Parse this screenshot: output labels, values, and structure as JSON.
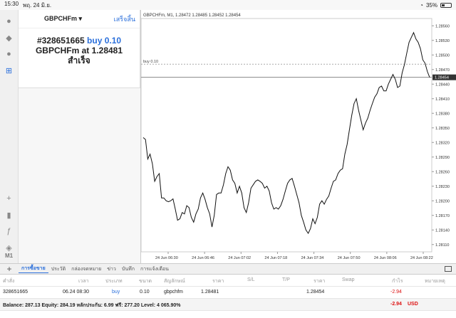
{
  "status": {
    "time": "15:30",
    "date": "พฤ. 24 มิ.ย.",
    "battery": "35%"
  },
  "sidebar": {
    "timeframe": "M1"
  },
  "order_panel": {
    "symbol": "GBPCHFm",
    "done": "เสร็จสิ้น",
    "ticket": "#328651665",
    "action": "buy 0.10",
    "line2_prefix": "GBPCHFm at",
    "line2_price": "1.28481",
    "status": "สำเร็จ"
  },
  "chart": {
    "header": "GBPCHFm, M1, 1.28472 1.28485 1.28452 1.28454",
    "buy_label": "buy 0.10",
    "current_price": "1.28454",
    "y_ticks": [
      "1.28560",
      "1.28530",
      "1.28500",
      "1.28470",
      "1.28440",
      "1.28410",
      "1.28380",
      "1.28350",
      "1.28320",
      "1.28290",
      "1.28260",
      "1.28230",
      "1.28200",
      "1.28170",
      "1.28140",
      "1.28110"
    ],
    "x_ticks": [
      "24 Jun 06:30",
      "24 Jun 06:46",
      "24 Jun 07:02",
      "24 Jun 07:18",
      "24 Jun 07:34",
      "24 Jun 07:50",
      "24 Jun 08:06",
      "24 Jun 08:22"
    ]
  },
  "chart_data": {
    "type": "line",
    "title": "GBPCHFm, M1, 1.28472 1.28485 1.28452 1.28454",
    "xlabel": "",
    "ylabel": "",
    "ylim": [
      1.28095,
      1.28575
    ],
    "series": [
      {
        "values": [
          1.2833,
          1.28326,
          1.28286,
          1.28296,
          1.28276,
          1.2824,
          1.2825,
          1.28256,
          1.28206,
          1.28206,
          1.282,
          1.28198,
          1.282,
          1.28204,
          1.28183,
          1.2816,
          1.28163,
          1.28176,
          1.28173,
          1.2819,
          1.28186,
          1.28166,
          1.28156,
          1.28173,
          1.28183,
          1.28206,
          1.28216,
          1.28203,
          1.28186,
          1.28173,
          1.28146,
          1.2817,
          1.28213,
          1.28216,
          1.28216,
          1.28233,
          1.28256,
          1.2827,
          1.28263,
          1.28243,
          1.28236,
          1.28216,
          1.2823,
          1.28216,
          1.28186,
          1.28176,
          1.28196,
          1.28226,
          1.28233,
          1.2824,
          1.28243,
          1.2824,
          1.28236,
          1.28226,
          1.2823,
          1.2822,
          1.28196,
          1.28183,
          1.28186,
          1.28183,
          1.2819,
          1.28203,
          1.2822,
          1.28236,
          1.28243,
          1.28246,
          1.2823,
          1.28213,
          1.28196,
          1.2817,
          1.28156,
          1.2814,
          1.28133,
          1.28143,
          1.28163,
          1.28153,
          1.28166,
          1.28193,
          1.282,
          1.28193,
          1.28203,
          1.2821,
          1.28226,
          1.2824,
          1.28243,
          1.28256,
          1.28263,
          1.28266,
          1.28296,
          1.28316,
          1.28346,
          1.28376,
          1.284,
          1.2841,
          1.28386,
          1.28366,
          1.28346,
          1.2836,
          1.2837,
          1.28386,
          1.284,
          1.28413,
          1.2842,
          1.28433,
          1.28436,
          1.28426,
          1.28426,
          1.2844,
          1.2845,
          1.2846,
          1.2845,
          1.28433,
          1.28436,
          1.28463,
          1.2848,
          1.28503,
          1.28526,
          1.28536,
          1.28546,
          1.28533,
          1.28526,
          1.28513,
          1.2849,
          1.28483,
          1.28466,
          1.28454
        ]
      }
    ]
  },
  "tabs": [
    "การซื้อขาย",
    "ประวัติ",
    "กล่องจดหมาย",
    "ข่าว",
    "บันทึก",
    "การแจ้งเตือน"
  ],
  "table": {
    "headers": [
      "คำสั่ง",
      "เวลา",
      "ประเภท",
      "ขนาด",
      "สัญลักษณ์",
      "ราคา",
      "S/L",
      "T/P",
      "ราคา",
      "Swap",
      "กำไร",
      "หมายเหตุ"
    ],
    "row": [
      "328651665",
      "06.24 08:30",
      "buy",
      "0.10",
      "gbpchfm",
      "1.28481",
      "",
      "",
      "1.28454",
      "",
      "-2.94",
      ""
    ],
    "balance": "Balance: 287.13 Equity: 284.19 หลักประกัน: 6.99 ฟรี: 277.20 Level: 4 065.90%",
    "total": "-2.94",
    "currency": "USD"
  }
}
